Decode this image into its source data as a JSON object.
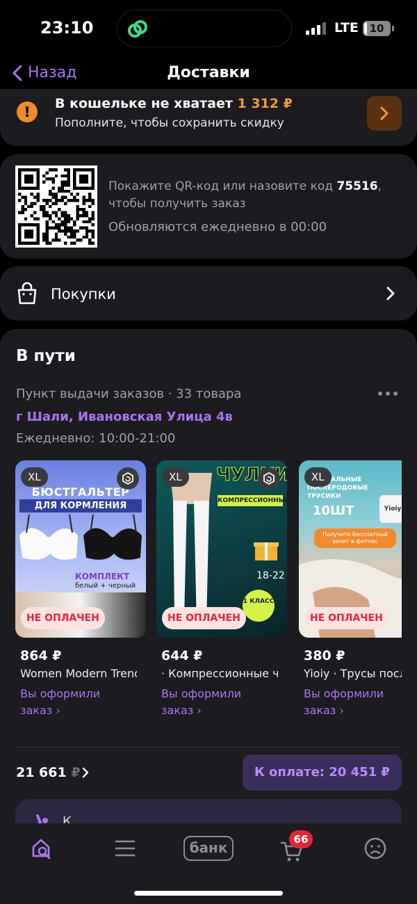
{
  "status_bar": {
    "time": "23:10",
    "network": "LTE",
    "battery": "10",
    "battery_level": 0.1
  },
  "nav": {
    "back_label": "Назад",
    "title": "Доставки"
  },
  "wallet": {
    "title": "В кошельке не хватает",
    "amount": "1 312 ₽",
    "subtitle": "Пополните, чтобы сохранить скидку",
    "warn_symbol": "!"
  },
  "qr": {
    "text_before_code": "Покажите QR-код или назовите код ",
    "code": "75516",
    "text_after_code": ", чтобы получить заказ",
    "update_note": "Обновляются ежедневно в 00:00"
  },
  "purchases": {
    "label": "Покупки"
  },
  "transit": {
    "title": "В пути",
    "pickup_line": "Пункт выдачи заказов · 33 товара",
    "address": "г Шали, Ивановская Улица 4в",
    "hours": "Ежедневно: 10:00-21:00",
    "products": [
      {
        "size": "XL",
        "badge": "НЕ ОПЛАЧЕН",
        "price": "864 ₽",
        "name": "Women Modern Trend",
        "status_line1": "Вы оформили",
        "status_line2": "заказ ›",
        "img_line1": "БЮСТГАЛЬТЕР",
        "img_line2": "ДЛЯ КОРМЛЕНИЯ",
        "img_line3": "КОМПЛЕКТ",
        "img_line4": "белый + черный"
      },
      {
        "size": "XL",
        "badge": "НЕ ОПЛАЧЕН",
        "price": "644 ₽",
        "name": "· Компрессионные чулки",
        "status_line1": "Вы оформили",
        "status_line2": "заказ ›",
        "img_line1": "ЧУЛКИ",
        "img_line2": "КОМПРЕССИОННЫЕ",
        "img_line3": "18-22",
        "img_line4": "1 КЛАСС"
      },
      {
        "size": "XL",
        "badge": "НЕ ОПЛАЧЕН",
        "price": "380 ₽",
        "name": "Yioiy · Трусы послеродовые",
        "status_line1": "Вы оформили",
        "status_line2": "заказ ›",
        "img_line1": "ЛЬТРУАЛЬНЫЕ ПОСЛЕРОДОВЫЕ ТРУСИКИ",
        "img_line2": "10ШТ",
        "img_line3": "Yioiy",
        "img_line4": "Получите бесплатный визит в фитнес"
      }
    ],
    "total_old_num": "21 661",
    "total_old_cur": "₽",
    "pay_button": "К оплате: 20 451 ₽",
    "next_letter": "К"
  },
  "tabbar": {
    "bank_label": "банк",
    "cart_badge": "66",
    "icons": [
      "search-home-icon",
      "catalog-icon",
      "bank-icon",
      "cart-icon",
      "profile-icon"
    ]
  },
  "colors": {
    "accent": "#a974f0",
    "warning": "#f08a2c",
    "unpaid": "#e0283a",
    "card": "#1c1b20"
  }
}
